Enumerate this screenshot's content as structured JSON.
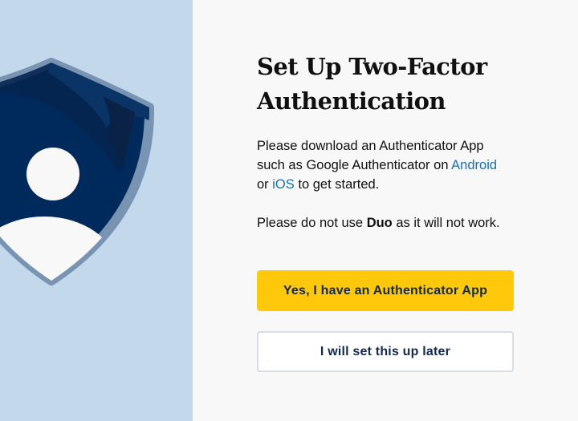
{
  "header": {
    "title_line1": "Set Up Two-Factor",
    "title_line2": "Authentication"
  },
  "instructions": {
    "line1": "Please download an Authenticator App",
    "line2_prefix": "such as Google Authenticator on ",
    "android_link": "Android",
    "line3_prefix": "or ",
    "ios_link": "iOS",
    "line3_suffix": " to get started."
  },
  "warning": {
    "prefix": "Please do not use ",
    "bold": "Duo",
    "suffix": " as it will not work."
  },
  "actions": {
    "primary_label": "Yes, I have an Authenticator App",
    "secondary_label": "I will set this up later"
  },
  "colors": {
    "left_panel_bg": "#c3d8ea",
    "shield_navy": "#012a5c",
    "shield_outline": "#7993b2",
    "primary_button": "#ffc80a",
    "link": "#1a6ea8",
    "button_text": "#12284c"
  },
  "icons": {
    "illustration": "shield-user-icon"
  }
}
